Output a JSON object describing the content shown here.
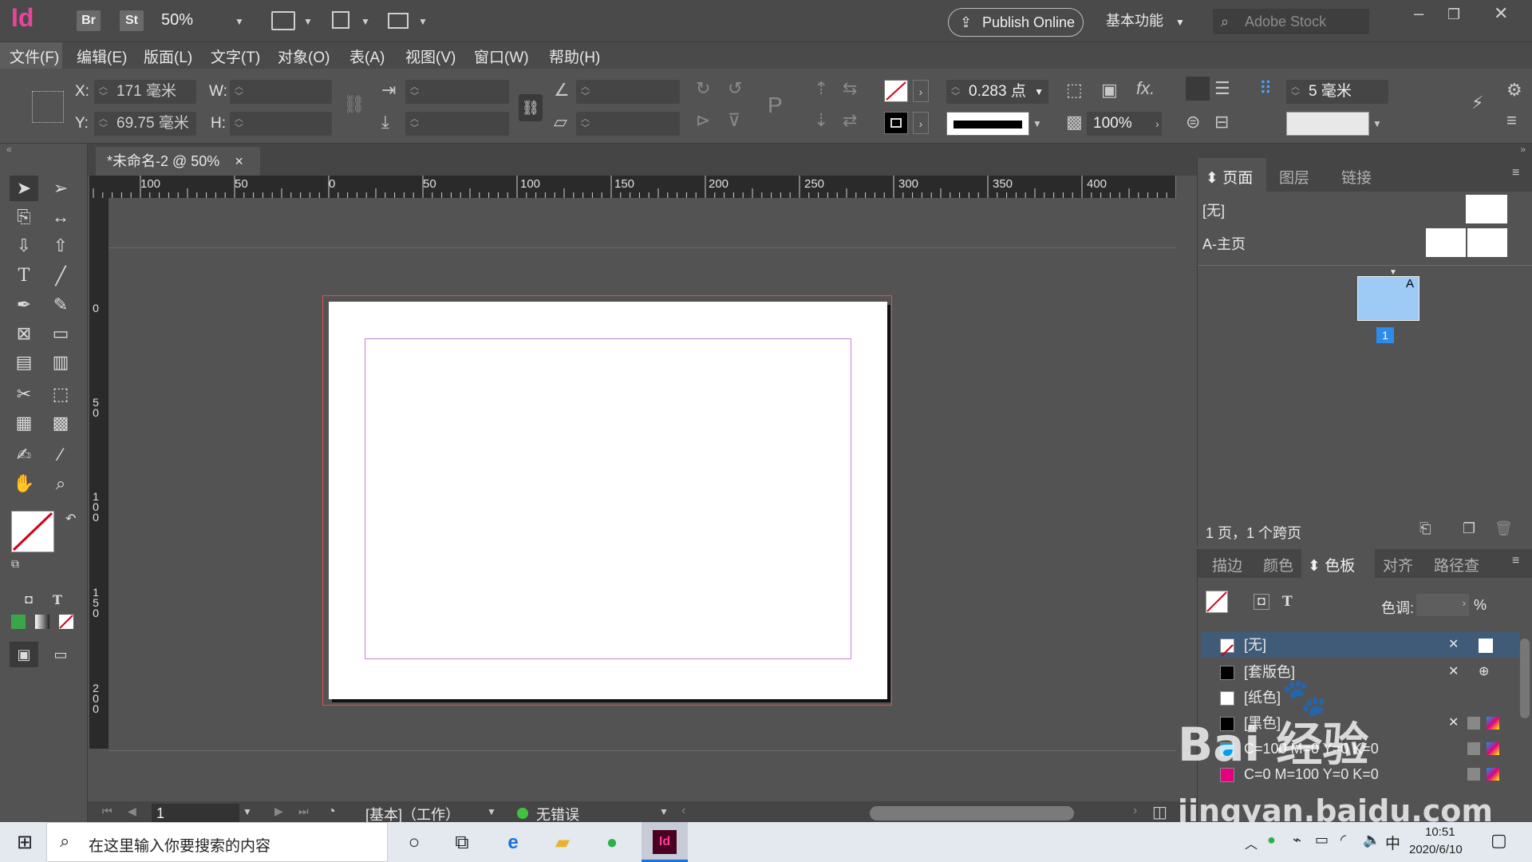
{
  "app": {
    "logo": "Id",
    "bridge_label": "Br",
    "stock_btn_label": "St",
    "zoom": "50%",
    "publish_label": "Publish Online",
    "workspace_label": "基本功能",
    "stock_search_placeholder": "Adobe Stock"
  },
  "menu": [
    "文件(F)",
    "编辑(E)",
    "版面(L)",
    "文字(T)",
    "对象(O)",
    "表(A)",
    "视图(V)",
    "窗口(W)",
    "帮助(H)"
  ],
  "control": {
    "x_label": "X:",
    "x_value": "171 毫米",
    "y_label": "Y:",
    "y_value": "69.75 毫米",
    "w_label": "W:",
    "h_label": "H:",
    "stroke_weight": "0.283 点",
    "opacity": "100%",
    "spacing": "5 毫米",
    "fx_label": "fx."
  },
  "document": {
    "tab_title": "*未命名-2 @ 50%",
    "close_glyph": "×",
    "hruler_labels": [
      "100",
      "50",
      "0",
      "50",
      "100",
      "150",
      "200",
      "250",
      "300",
      "350",
      "400"
    ],
    "vruler_labels": [
      "0",
      "5\n0",
      "1\n0\n0",
      "1\n5\n0",
      "2\n0\n0"
    ]
  },
  "status": {
    "page_number": "1",
    "mode": "[基本]（工作）",
    "preflight": "无错误"
  },
  "pages_panel": {
    "tabs": [
      "页面",
      "图层",
      "链接"
    ],
    "masters": [
      "[无]",
      "A-主页"
    ],
    "page_master_letter": "A",
    "page_label": "1",
    "summary": "1 页，1 个跨页"
  },
  "swatches_panel": {
    "tabs": [
      "描边",
      "颜色",
      "色板",
      "对齐",
      "路径查"
    ],
    "tint_label": "色调:",
    "percent": "%",
    "swatches": [
      {
        "name": "[无]",
        "color": "#ffffff"
      },
      {
        "name": "[套版色]",
        "color": "#000000"
      },
      {
        "name": "[纸色]",
        "color": "#ffffff"
      },
      {
        "name": "[黑色]",
        "color": "#000000"
      },
      {
        "name": "C=100 M=0 Y=0 K=0",
        "color": "#00a0e9"
      },
      {
        "name": "C=0 M=100 Y=0 K=0",
        "color": "#e4007f"
      }
    ]
  },
  "taskbar": {
    "search_placeholder": "在这里输入你要搜索的内容",
    "time": "10:51",
    "date": "2020/6/10",
    "ime": "中"
  },
  "watermark": {
    "brand": "Bai 经验",
    "url": "jingyan.baidu.com"
  },
  "colors": {
    "accent": "#e8459b",
    "page_bleed": "#d9534f",
    "margin_guide": "#c77dd6",
    "selected_row": "#3f5b78",
    "page_thumb": "#9ecbf5"
  }
}
